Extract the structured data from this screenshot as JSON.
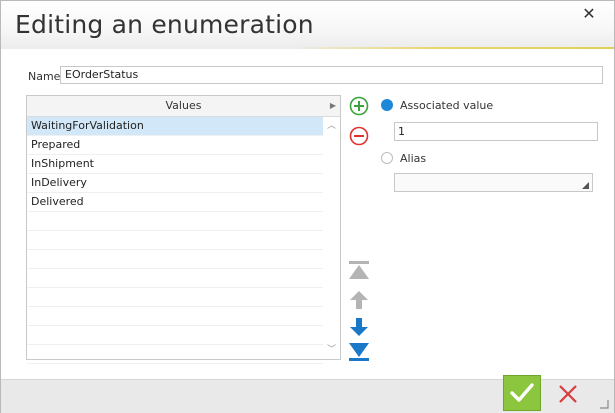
{
  "dialog": {
    "title": "Editing an enumeration",
    "close_glyph": "✕"
  },
  "name_field": {
    "label": "Name",
    "value": "EOrderStatus"
  },
  "values_list": {
    "header": "Values",
    "items": [
      {
        "label": "WaitingForValidation",
        "selected": true
      },
      {
        "label": "Prepared",
        "selected": false
      },
      {
        "label": "InShipment",
        "selected": false
      },
      {
        "label": "InDelivery",
        "selected": false
      },
      {
        "label": "Delivered",
        "selected": false
      }
    ]
  },
  "options": {
    "associated_value_label": "Associated value",
    "associated_value": "1",
    "alias_label": "Alias",
    "alias_value": "",
    "selected_option": "associated_value"
  },
  "colors": {
    "accent_blue": "#1e88d8",
    "ok_green": "#8cc63f",
    "cancel_red": "#d83b3b",
    "add_green": "#3aa23a",
    "remove_red": "#e03030",
    "selection": "#d2e7f7"
  },
  "icons": {
    "add": "add-circle-icon",
    "remove": "remove-circle-icon",
    "move_top": "move-top-icon",
    "move_up": "arrow-up-icon",
    "move_down": "arrow-down-icon",
    "move_bottom": "move-bottom-icon",
    "ok": "checkmark-icon",
    "cancel": "cross-icon"
  }
}
